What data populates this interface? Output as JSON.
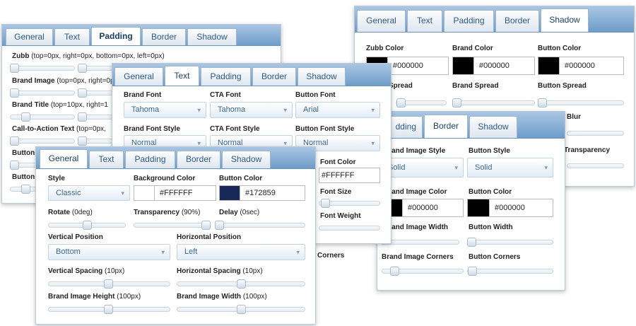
{
  "tabs": [
    "General",
    "Text",
    "Padding",
    "Border",
    "Shadow"
  ],
  "padding_panel": {
    "zubb": {
      "label": "Zubb",
      "detail": "(top=0px, right=0px, bottom=0px, left=0px)"
    },
    "brand_image": {
      "label": "Brand Image",
      "detail": "(top=0px, right=0px,"
    },
    "brand_title": {
      "label": "Brand Title",
      "detail": "(top=10px, right=1"
    },
    "cta_text": {
      "label": "Call-to-Action Text",
      "detail": "(top=0px,"
    },
    "button_partial": "Button",
    "button2_partial": "Button"
  },
  "shadow_panel": {
    "zubb_color": "Zubb Color",
    "brand_color": "Brand Color",
    "button_color": "Button Color",
    "zubb_hex": "#000000",
    "brand_hex": "#000000",
    "button_hex": "#000000",
    "spread_partial": "Spread",
    "brand_spread": "Brand Spread",
    "button_spread": "Button Spread",
    "blur_partial": "Blur",
    "transparency_partial": "Transparency"
  },
  "border_panel": {
    "padding_partial": "dding",
    "brand_image_style": "Brand Image Style",
    "button_style": "Button Style",
    "brand_style_value": "Solid",
    "button_style_value": "Solid",
    "brand_image_color": "Brand Image Color",
    "button_color": "Button Color",
    "brand_hex": "#000000",
    "button_hex": "#000000",
    "brand_image_width": "Brand Image Width",
    "button_width": "Button Width",
    "corners_partial": "Corners",
    "brand_image_corners": "Brand Image Corners",
    "button_corners": "Button Corners"
  },
  "text_panel": {
    "brand_font": "Brand Font",
    "cta_font": "CTA Font",
    "button_font": "Button Font",
    "brand_font_value": "Tahoma",
    "cta_font_value": "Tahoma",
    "button_font_value": "Arial",
    "brand_font_style": "Brand Font Style",
    "cta_font_style": "CTA Font Style",
    "button_font_style": "Button Font Style",
    "brand_style_value": "Normal",
    "cta_style_value": "Normal",
    "button_style_value": "Normal",
    "font_color": "Font Color",
    "font_color_hex": "#FFFFFF",
    "font_size": "Font Size",
    "font_weight": "Font Weight"
  },
  "general_panel": {
    "style": "Style",
    "style_value": "Classic",
    "background_color": "Background Color",
    "background_hex": "#FFFFFF",
    "button_color": "Button Color",
    "button_hex": "#172859",
    "rotate": {
      "label": "Rotate",
      "detail": "(0deg)"
    },
    "transparency": {
      "label": "Transparency",
      "detail": "(90%)"
    },
    "delay": {
      "label": "Delay",
      "detail": "(0sec)"
    },
    "vertical_position": "Vertical Position",
    "vertical_position_value": "Bottom",
    "horizontal_position": "Horizontal Position",
    "horizontal_position_value": "Left",
    "vertical_spacing": {
      "label": "Vertical Spacing",
      "detail": "(10px)"
    },
    "horizontal_spacing": {
      "label": "Horizontal Spacing",
      "detail": "(10px)"
    },
    "brand_image_height": {
      "label": "Brand Image Height",
      "detail": "(100px)"
    },
    "brand_image_width": {
      "label": "Brand Image Width",
      "detail": "(100px)"
    }
  },
  "colors": {
    "tabbar": "#7aa6d2",
    "tab_text": "#2d5a86",
    "select_text": "#3d6890",
    "swatch_black": "#000000",
    "swatch_white": "#FFFFFF",
    "swatch_navy": "#172859"
  }
}
